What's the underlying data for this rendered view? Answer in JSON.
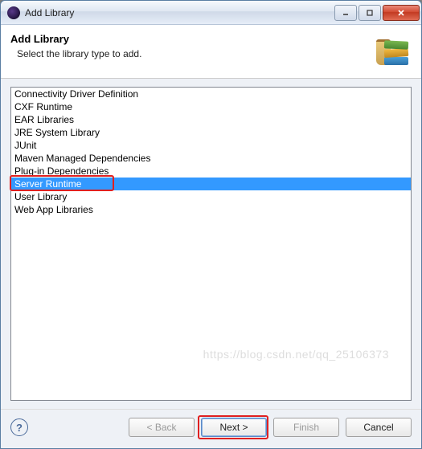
{
  "window": {
    "title": "Add Library"
  },
  "header": {
    "title": "Add Library",
    "subtitle": "Select the library type to add."
  },
  "list": {
    "items": [
      "Connectivity Driver Definition",
      "CXF Runtime",
      "EAR Libraries",
      "JRE System Library",
      "JUnit",
      "Maven Managed Dependencies",
      "Plug-in Dependencies",
      "Server Runtime",
      "User Library",
      "Web App Libraries"
    ],
    "selected_index": 7
  },
  "buttons": {
    "back": "< Back",
    "next": "Next >",
    "finish": "Finish",
    "cancel": "Cancel"
  },
  "watermark": "https://blog.csdn.net/qq_25106373"
}
